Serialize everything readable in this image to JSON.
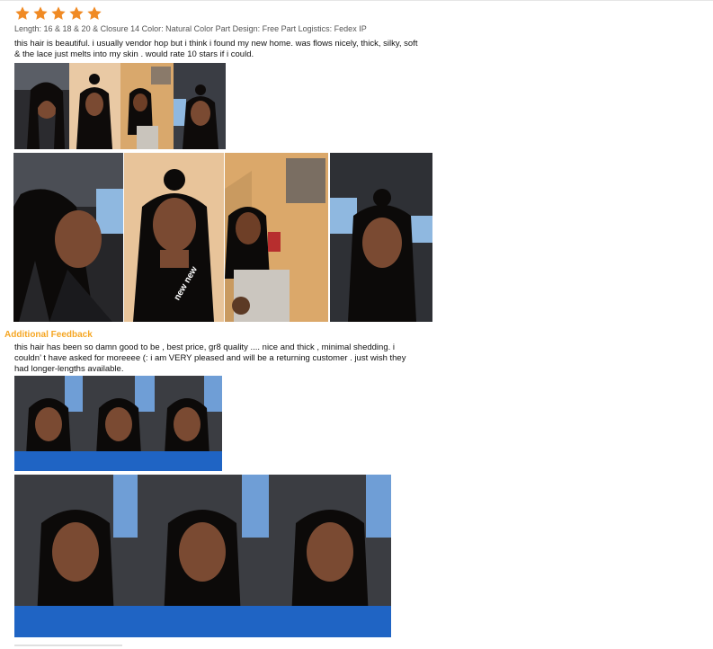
{
  "review1": {
    "rating": 5,
    "star_color": "#f08a24",
    "meta": "Length: 16 & 18 & 20 & Closure 14 Color: Natural Color Part Design: Free Part Logistics: Fedex IP",
    "text": "this hair is beautiful. i usually vendor hop but i think i found my new home. was flows nicely, thick, silky, soft & the lace just melts into my skin . would rate 10 stars if i could.",
    "photo_caption": "new new"
  },
  "additional": {
    "heading": "Additional Feedback",
    "heading_color": "#f5a623",
    "text": "this hair has been so damn good to be , best price, gr8 quality .... nice and thick , minimal shedding. i couldn’ t have asked for moreeee (: i am VERY pleased and will be a returning customer . just wish they had longer-lengths available."
  }
}
